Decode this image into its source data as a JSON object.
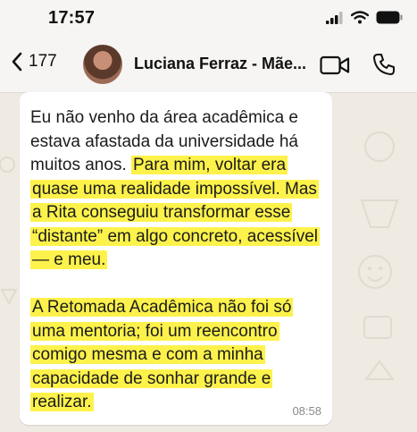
{
  "status_bar": {
    "time": "17:57"
  },
  "header": {
    "back_count": "177",
    "contact_name": "Luciana Ferraz - Mãe...",
    "icons": [
      "back-chevron-icon",
      "video-call-icon",
      "phone-call-icon"
    ]
  },
  "message": {
    "p1_plain": "Eu não venho da área acadêmica e estava afastada da universidade há muitos anos. ",
    "p1_highlight": "Para mim, voltar era quase uma realidade impossível. Mas a Rita conseguiu transformar esse “distante” em algo concreto, acessível — e meu.",
    "p2_highlight": "A Retomada Acadêmica não foi só uma mentoria; foi um reencontro comigo mesma e com a minha capacidade de sonhar grande e realizar.",
    "time": "08:58"
  },
  "colors": {
    "highlight": "#fdf24b",
    "chat_background": "#efeae2",
    "bubble": "#ffffff"
  }
}
